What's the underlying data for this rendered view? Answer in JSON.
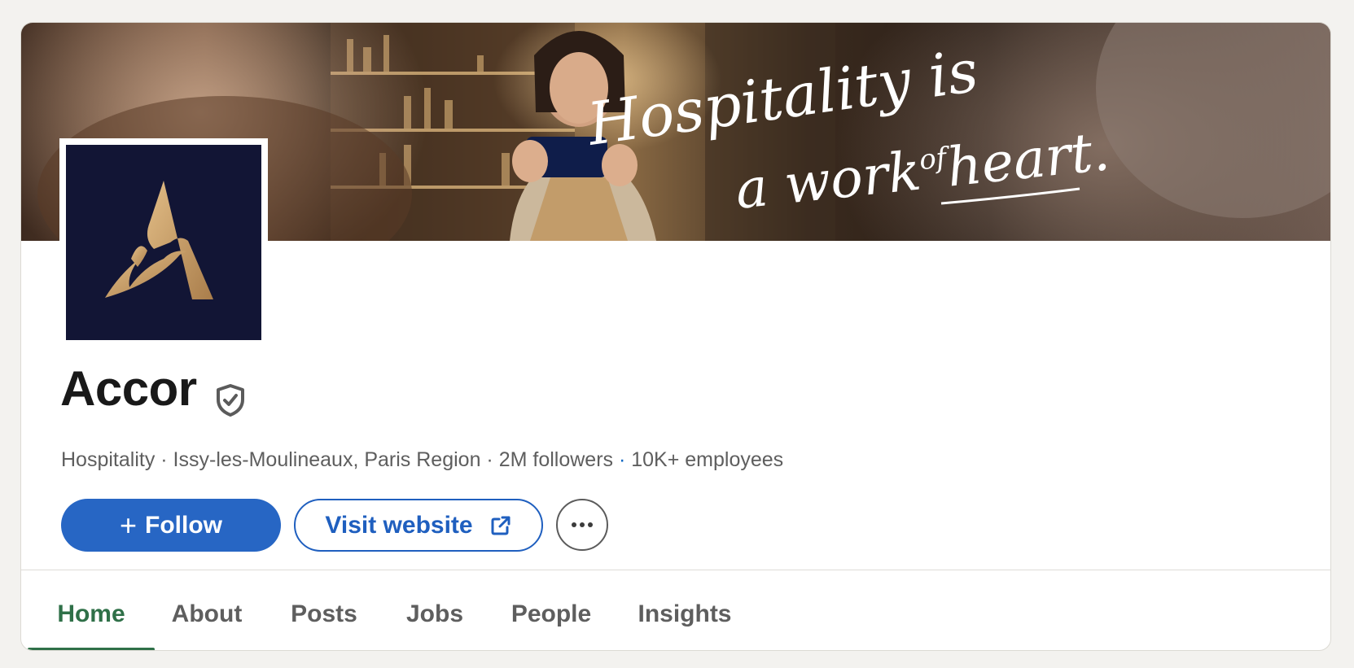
{
  "cover": {
    "tagline_line1": "Hospitality is",
    "tagline_line2_pre": "a work",
    "tagline_line2_of": "of",
    "tagline_line2_heart": "heart",
    "tagline_line2_dot": "."
  },
  "company": {
    "name": "Accor",
    "logo_letter": "A",
    "meta": {
      "industry": "Hospitality",
      "separator": " · ",
      "location": "Issy-les-Moulineaux, Paris Region",
      "followers": "2M followers",
      "employees": "10K+ employees"
    }
  },
  "actions": {
    "follow_icon": "+",
    "follow_label": "Follow",
    "visit_label": "Visit website",
    "more_label": "···"
  },
  "tabs": [
    {
      "label": "Home",
      "active": true
    },
    {
      "label": "About",
      "active": false
    },
    {
      "label": "Posts",
      "active": false
    },
    {
      "label": "Jobs",
      "active": false
    },
    {
      "label": "People",
      "active": false
    },
    {
      "label": "Insights",
      "active": false
    }
  ],
  "colors": {
    "primary_blue": "#2766c4",
    "active_tab_green": "#2f7048",
    "logo_navy": "#121535",
    "logo_gold": "#c9a06a"
  },
  "icons": {
    "verified": "shield-check-icon",
    "external": "external-link-icon",
    "more": "ellipsis-icon"
  }
}
